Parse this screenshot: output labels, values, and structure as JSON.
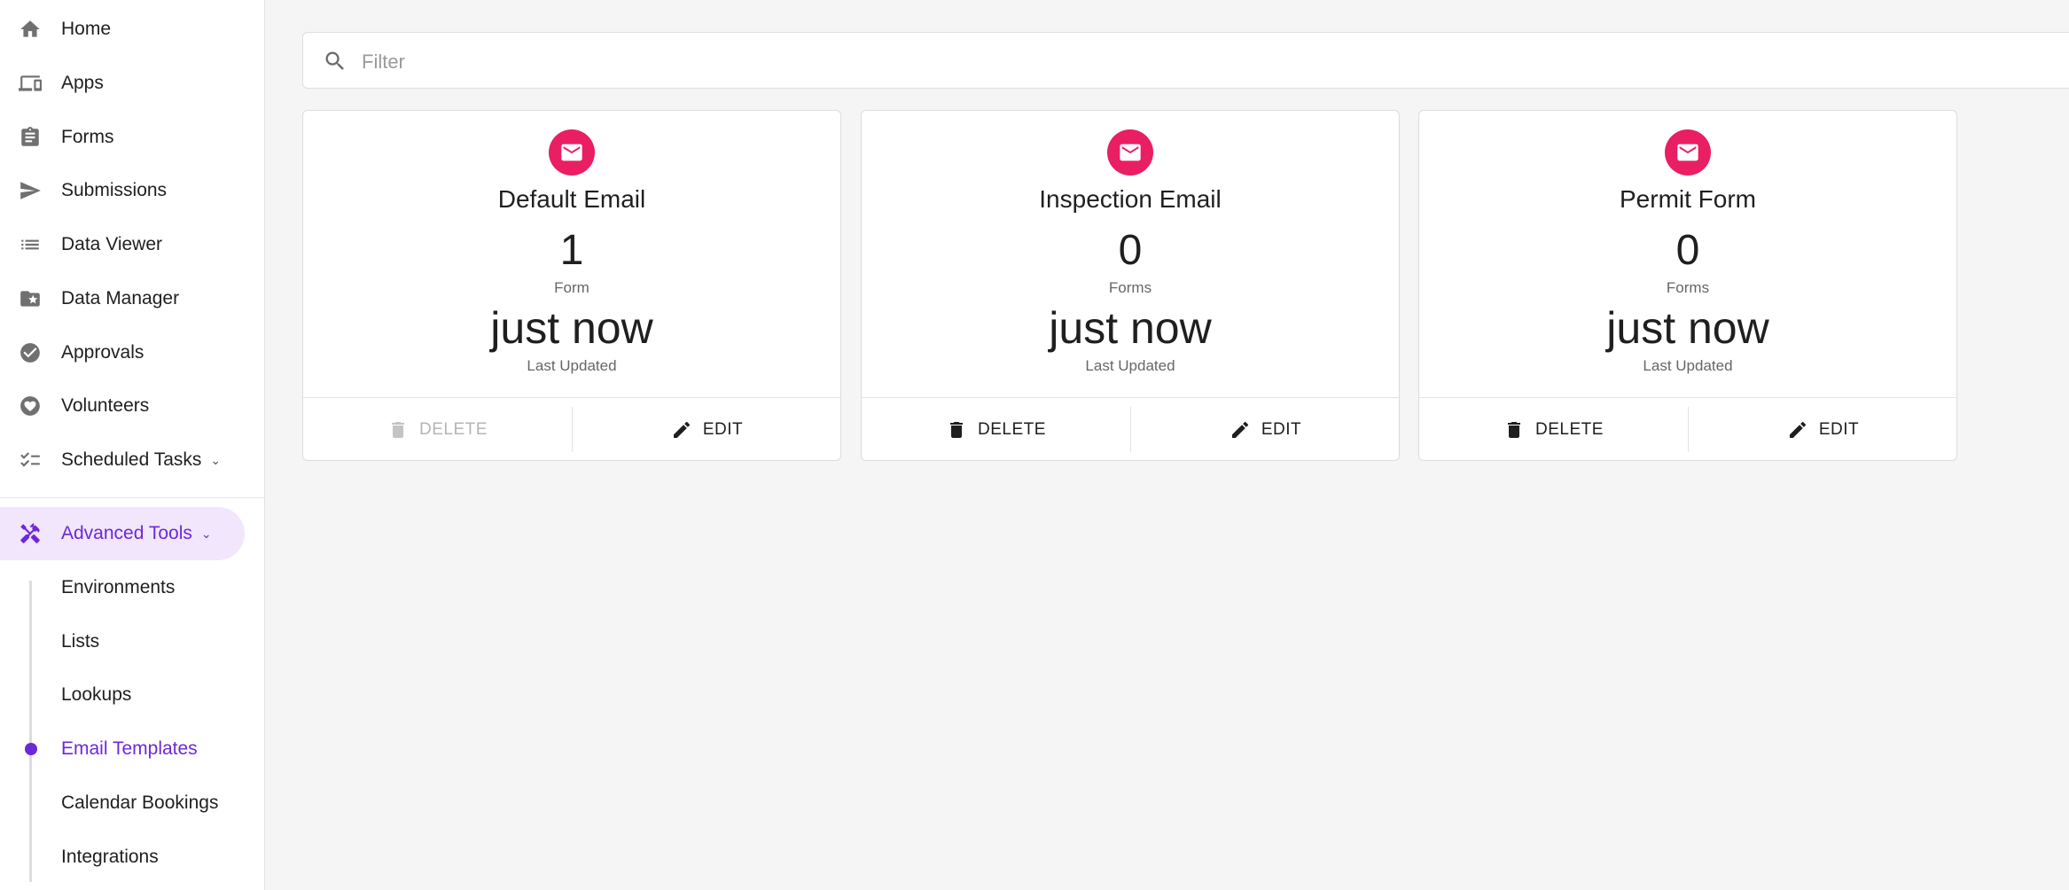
{
  "sidebar": {
    "items": [
      {
        "label": "Home",
        "icon": "home-icon"
      },
      {
        "label": "Apps",
        "icon": "devices-icon"
      },
      {
        "label": "Forms",
        "icon": "clipboard-icon"
      },
      {
        "label": "Submissions",
        "icon": "send-icon"
      },
      {
        "label": "Data Viewer",
        "icon": "list-icon"
      },
      {
        "label": "Data Manager",
        "icon": "folder-star-icon"
      },
      {
        "label": "Approvals",
        "icon": "check-circle-icon"
      },
      {
        "label": "Volunteers",
        "icon": "heart-circle-icon"
      },
      {
        "label": "Scheduled Tasks",
        "icon": "checklist-icon",
        "chevron": "⌄"
      }
    ],
    "advanced": {
      "label": "Advanced Tools",
      "icon": "tools-icon",
      "chevron": "⌄"
    },
    "subitems": [
      {
        "label": "Environments"
      },
      {
        "label": "Lists"
      },
      {
        "label": "Lookups"
      },
      {
        "label": "Email Templates"
      },
      {
        "label": "Calendar Bookings"
      },
      {
        "label": "Integrations"
      }
    ],
    "active_subitem": "Email Templates"
  },
  "filter": {
    "placeholder": "Filter",
    "value": ""
  },
  "cards": [
    {
      "title": "Default Email",
      "count": "1",
      "count_label": "Form",
      "updated": "just now",
      "updated_label": "Last Updated",
      "delete_label": "DELETE",
      "edit_label": "EDIT",
      "delete_disabled": true
    },
    {
      "title": "Inspection Email",
      "count": "0",
      "count_label": "Forms",
      "updated": "just now",
      "updated_label": "Last Updated",
      "delete_label": "DELETE",
      "edit_label": "EDIT",
      "delete_disabled": false
    },
    {
      "title": "Permit Form",
      "count": "0",
      "count_label": "Forms",
      "updated": "just now",
      "updated_label": "Last Updated",
      "delete_label": "DELETE",
      "edit_label": "EDIT",
      "delete_disabled": false
    }
  ],
  "colors": {
    "accent": "#6d28d9",
    "accent_bg": "#f1e6fb",
    "email_avatar": "#e91e63"
  }
}
